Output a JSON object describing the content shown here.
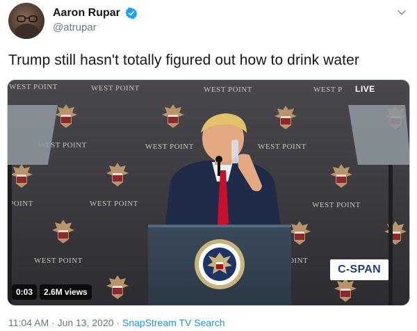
{
  "author": {
    "display_name": "Aaron Rupar",
    "handle": "@atrupar",
    "verified": true
  },
  "tweet": {
    "text": "Trump still hasn't totally figured out how to drink water"
  },
  "video": {
    "backdrop_labels": [
      "WEST POINT",
      "WEST POINT",
      "WEST POINT",
      "WEST P",
      "WEST POINT",
      "WEST POINT",
      "WEST POINT",
      "POINT",
      "WEST POINT",
      "WEST POINT",
      "WEST POINT",
      "OINT"
    ],
    "live_label": "LIVE",
    "network_logo": "C-SPAN",
    "current_time": "0:03",
    "views": "2.6M views"
  },
  "meta": {
    "time": "11:04 AM",
    "separator": "·",
    "date": "Jun 13, 2020",
    "source": "SnapStream TV Search"
  },
  "icons": {
    "verified": "verified-badge-icon",
    "chevron": "chevron-down-icon"
  },
  "colors": {
    "verified_blue": "#1da1f2",
    "link_blue": "#1b95e0",
    "muted_text": "#657786"
  }
}
